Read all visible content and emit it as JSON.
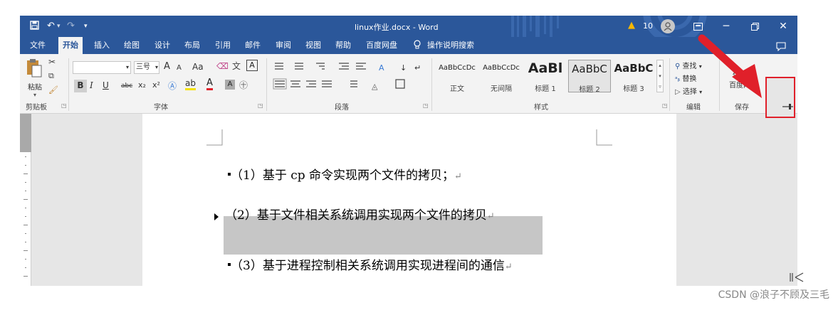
{
  "window": {
    "title": "linux作业.docx - Word",
    "warning_count": "10"
  },
  "tabs": [
    {
      "label": "文件"
    },
    {
      "label": "开始"
    },
    {
      "label": "插入"
    },
    {
      "label": "绘图"
    },
    {
      "label": "设计"
    },
    {
      "label": "布局"
    },
    {
      "label": "引用"
    },
    {
      "label": "邮件"
    },
    {
      "label": "审阅"
    },
    {
      "label": "视图"
    },
    {
      "label": "帮助"
    },
    {
      "label": "百度网盘"
    }
  ],
  "tell_me": "操作说明搜索",
  "ribbon": {
    "clipboard": {
      "paste_label": "粘贴",
      "group_label": "剪贴板"
    },
    "font": {
      "size_value": "三号",
      "group_label": "字体",
      "grow": "A",
      "shrink": "A",
      "case": "Aa",
      "bold": "B",
      "italic": "I",
      "underline": "U",
      "strike": "abc",
      "sub": "x₂",
      "sup": "x²"
    },
    "paragraph": {
      "group_label": "段落"
    },
    "styles": {
      "group_label": "样式",
      "items": [
        {
          "sample": "AaBbCcDc",
          "name": "正文"
        },
        {
          "sample": "AaBbCcDc",
          "name": "无间隔"
        },
        {
          "sample": "AaBl",
          "name": "标题 1"
        },
        {
          "sample": "AaBbC",
          "name": "标题 2"
        },
        {
          "sample": "AaBbC",
          "name": "标题 3"
        }
      ]
    },
    "editing": {
      "find": "查找",
      "replace": "替换",
      "select": "选择",
      "group_label": "编辑"
    },
    "save": {
      "label1": "保存到",
      "label2": "百度网盘",
      "group_label": "保存"
    }
  },
  "document": {
    "lines": [
      {
        "text": "（1）基于 cp 命令实现两个文件的拷贝；"
      },
      {
        "text": "（2）基于文件相关系统调用实现两个文件的拷贝"
      },
      {
        "text": "（3）基于进程控制相关系统调用实现进程间的通信"
      }
    ],
    "para_mark": "↵"
  },
  "watermark": "CSDN @浪子不顾及三毛",
  "colors": {
    "word_blue": "#2b579a",
    "annotation_red": "#e0202a",
    "selection_gray": "#c6c6c6"
  }
}
